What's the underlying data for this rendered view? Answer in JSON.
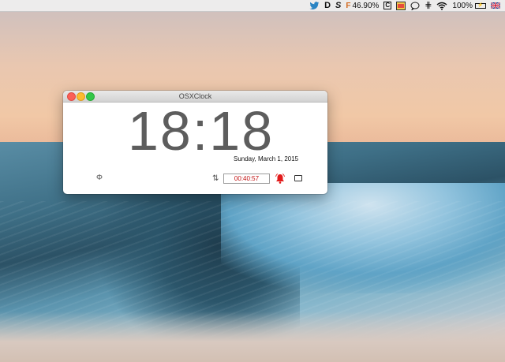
{
  "menubar": {
    "items": [
      {
        "name": "twitter-icon",
        "glyph": ""
      },
      {
        "name": "d-app-icon",
        "glyph": "D"
      },
      {
        "name": "s-app-icon",
        "glyph": "S"
      },
      {
        "name": "battery-monitor-icon",
        "glyph": "F",
        "text": "46.90%"
      },
      {
        "name": "c-app-icon",
        "glyph": "C"
      },
      {
        "name": "folder-app-icon",
        "glyph": ""
      },
      {
        "name": "chat-icon",
        "glyph": ""
      },
      {
        "name": "hash-icon",
        "glyph": "⋕"
      },
      {
        "name": "wifi-icon",
        "glyph": ""
      },
      {
        "name": "battery-icon",
        "text": "100%"
      },
      {
        "name": "flag-icon",
        "glyph": ""
      }
    ],
    "d_glyph": "D",
    "s_glyph": "S",
    "f_glyph": "F",
    "cpu_text": "46.90%",
    "c_glyph": "C",
    "hash_glyph": "⋕",
    "battery_text": "100%",
    "battery_inner": "⚡"
  },
  "window": {
    "title": "OSXClock",
    "time": "18:18",
    "date": "Sunday, March 1, 2015",
    "phi_glyph": "Φ",
    "sort_glyph": "⇅",
    "timer": "00:40:57"
  },
  "colors": {
    "timer_text": "#c01010",
    "bell": "#e21b1b",
    "close": "#fc5f57",
    "minimize": "#fdbb2e",
    "maximize": "#32c748"
  }
}
